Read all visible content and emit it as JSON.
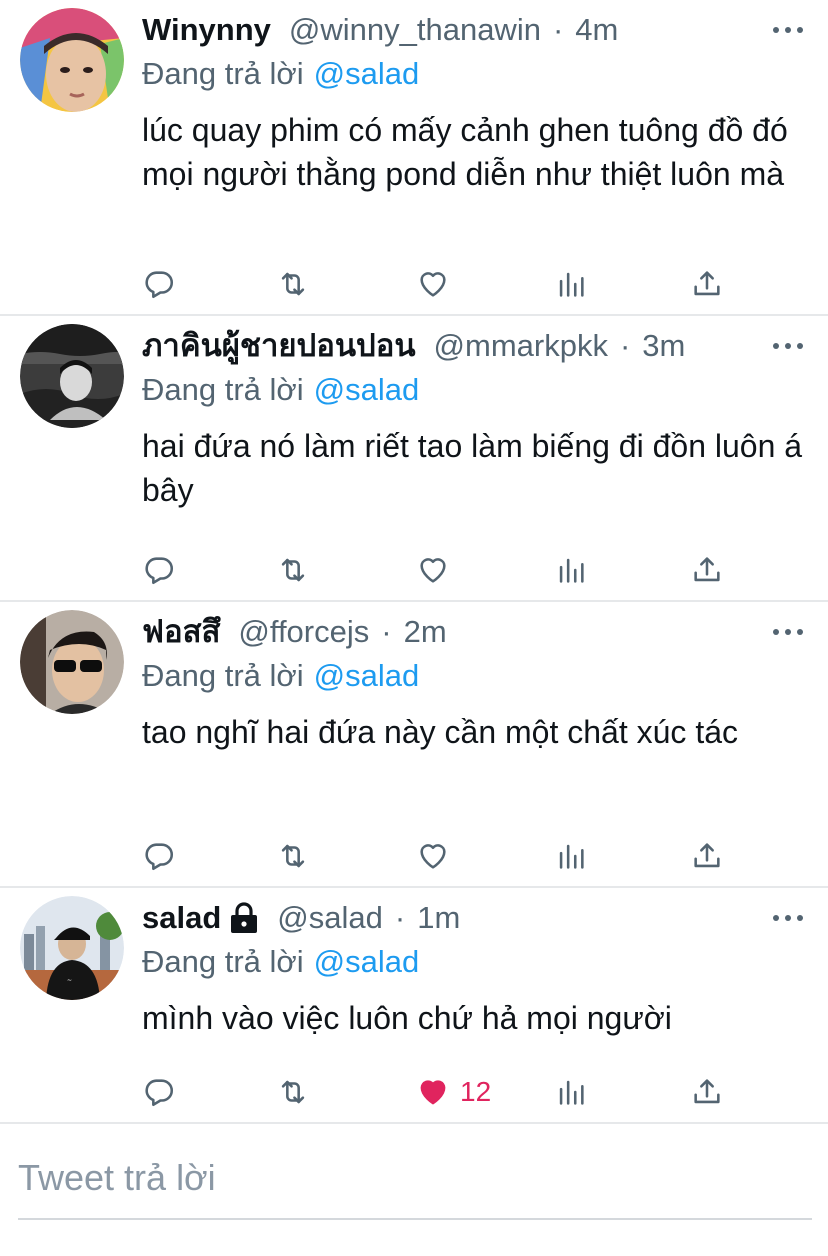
{
  "tweets": [
    {
      "name": "Winynny",
      "handle": "@winny_thanawin",
      "separator": "·",
      "time": "4m",
      "reply_prefix": "Đang trả lời",
      "reply_to": "@salad",
      "text": "lúc quay phim có mấy cảnh ghen tuông đồ đó mọi người thằng pond diễn như thiệt luôn mà",
      "locked": false,
      "liked": false,
      "like_count": ""
    },
    {
      "name": "ภาคินผู้ชายปอนปอน",
      "handle": "@mmarkpkk",
      "separator": "·",
      "time": "3m",
      "reply_prefix": "Đang trả lời",
      "reply_to": "@salad",
      "text": "hai đứa nó làm riết tao làm biếng đi đồn luôn á bây",
      "locked": false,
      "liked": false,
      "like_count": ""
    },
    {
      "name": "ฟอสสึ",
      "handle": "@fforcejs",
      "separator": "·",
      "time": "2m",
      "reply_prefix": "Đang trả lời",
      "reply_to": "@salad",
      "text": "tao nghĩ hai đứa này cần một chất xúc tác",
      "locked": false,
      "liked": false,
      "like_count": ""
    },
    {
      "name": "salad",
      "handle": "@salad",
      "separator": "·",
      "time": "1m",
      "reply_prefix": "Đang trả lời",
      "reply_to": "@salad",
      "text": "mình vào việc luôn chứ hả mọi người",
      "locked": true,
      "liked": true,
      "like_count": "12"
    }
  ],
  "composer": {
    "placeholder": "Tweet trả lời"
  },
  "icons": {
    "avatar": "avatar-photo",
    "more": "more-dots-icon",
    "lock": "lock-icon",
    "reply": "reply-bubble-icon",
    "retweet": "retweet-icon",
    "like": "heart-icon",
    "views": "analytics-bars-icon",
    "share": "share-upload-icon"
  },
  "colors": {
    "text": "#0f1419",
    "secondary": "#536471",
    "link": "#1d9bf0",
    "like_active": "#e0245e",
    "divider": "#e6e8ea"
  }
}
